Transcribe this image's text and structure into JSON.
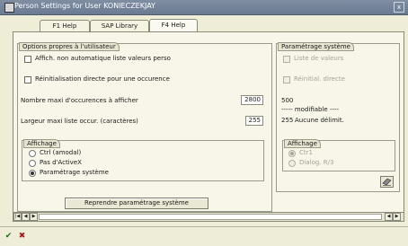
{
  "window": {
    "title": "Person Settings for User KONIECZEKJAY",
    "close_glyph": "x"
  },
  "tabs": [
    {
      "label": "F1 Help"
    },
    {
      "label": "SAP Library"
    },
    {
      "label": "F4 Help",
      "active": true
    }
  ],
  "user_options": {
    "title": "Options propres à l'utilisateur",
    "checkbox1_label": "Affich. non automatique liste valeurs perso",
    "checkbox2_label": "Réinitialisation directe pour une occurence",
    "max_occ_label": "Nombre maxi d'occurences à afficher",
    "max_occ_value": "2800",
    "max_width_label": "Largeur maxi liste occur. (caractères)",
    "max_width_value": "255",
    "display_group": {
      "title": "Affichage",
      "options": [
        "Ctrl (amodal)",
        "Pas d'ActiveX",
        "Paramétrage système"
      ],
      "selected_index": 2
    },
    "reset_button_label": "Reprendre paramétrage système"
  },
  "system_settings": {
    "title": "Paramétrage système",
    "checkbox1_label": "Liste de valeurs",
    "checkbox2_label": "Réinitial. directe",
    "max_occ_value": "500",
    "modifiable_text": "----- modifiable ----",
    "width_value": "255",
    "width_text": "Aucune délimit.",
    "display_group": {
      "title": "Affichage",
      "options": [
        "Ctr1",
        "Dialog. R/3"
      ],
      "selected_index": 0
    }
  },
  "icons": {
    "settings_button_icon": "eraser-icon",
    "confirm_icon": "checkmark-icon",
    "cancel_icon": "cancel-x-icon"
  },
  "footer": {
    "confirm_glyph": "✔",
    "cancel_glyph": "✖"
  }
}
